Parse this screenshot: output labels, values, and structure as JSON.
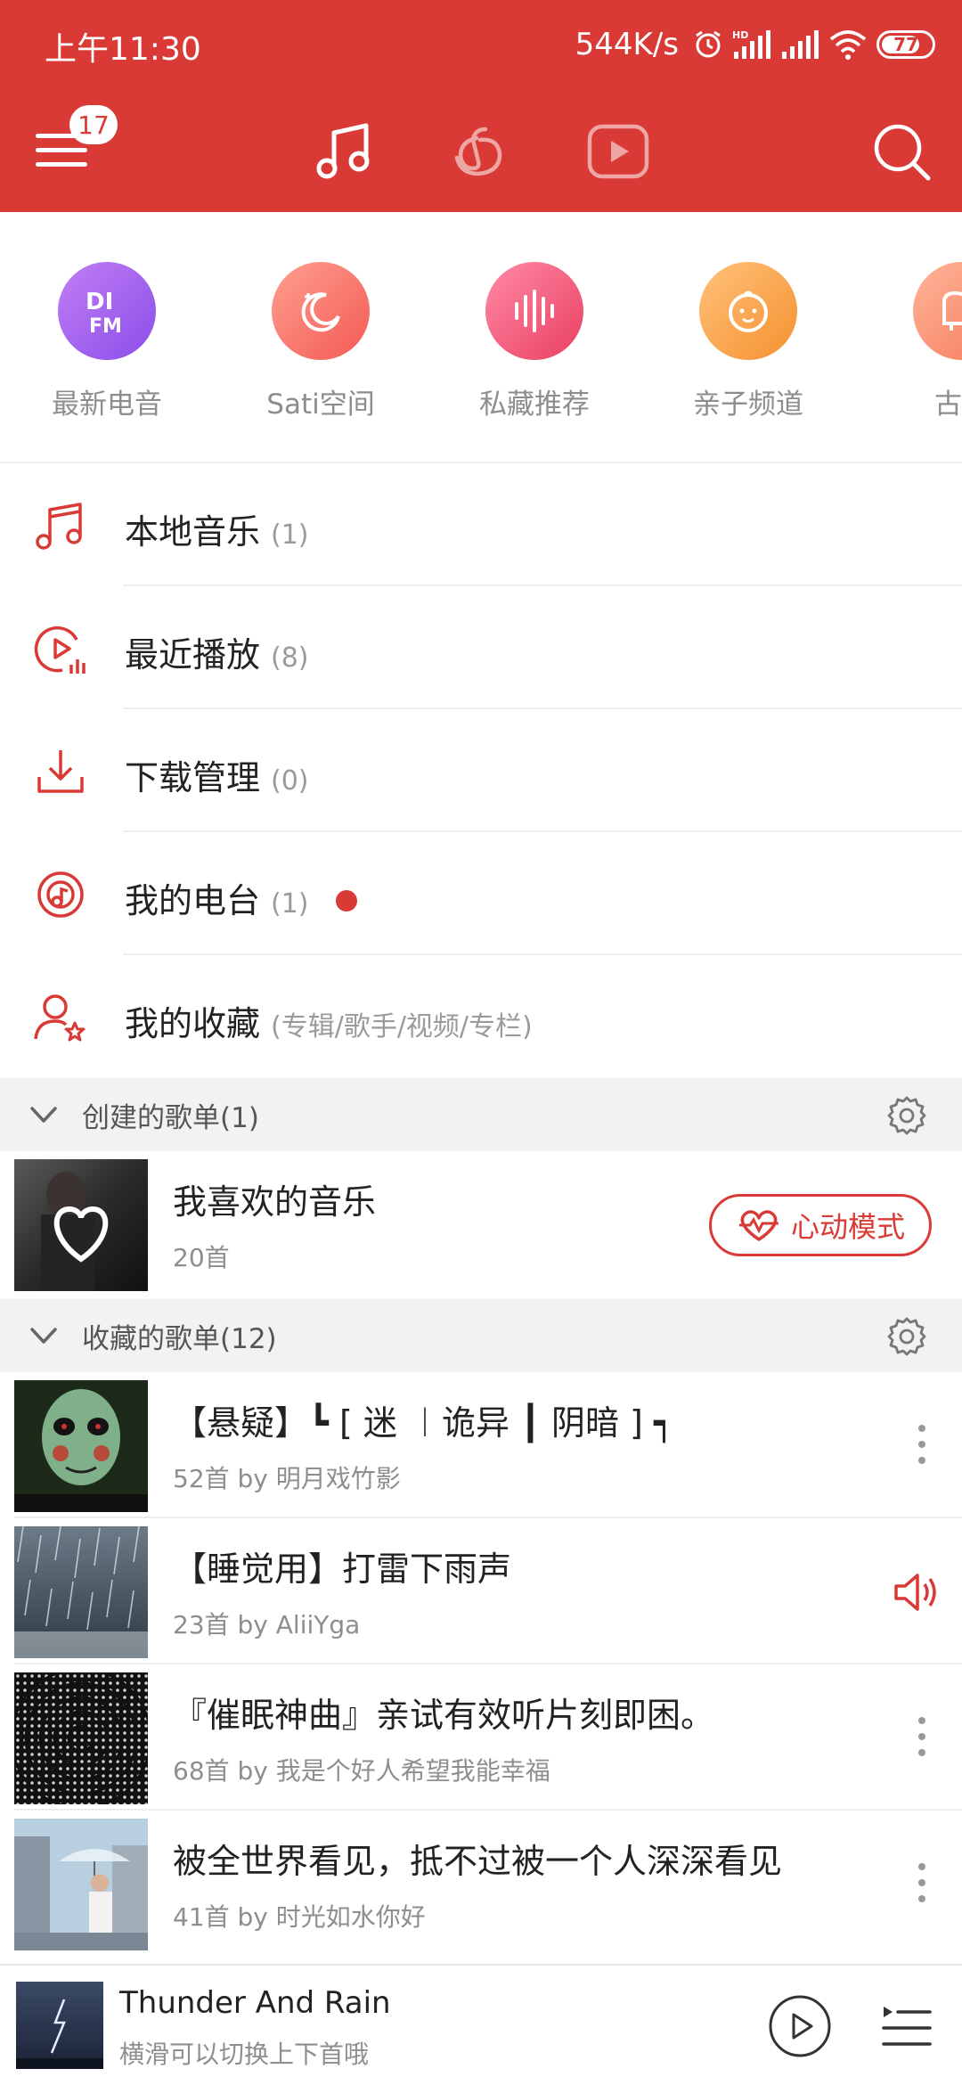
{
  "status_bar": {
    "time": "上午11:30",
    "speed": "544K/s",
    "battery": "77"
  },
  "nav": {
    "menu_badge": "17"
  },
  "channels": [
    {
      "label": "最新电音",
      "icon": "di-fm-icon"
    },
    {
      "label": "Sati空间",
      "icon": "moon-icon"
    },
    {
      "label": "私藏推荐",
      "icon": "sound-wave-icon"
    },
    {
      "label": "亲子频道",
      "icon": "baby-face-icon"
    },
    {
      "label": "古典",
      "icon": "piano-icon"
    }
  ],
  "my_items": [
    {
      "label": "本地音乐",
      "count": "(1)",
      "icon": "music-note-icon"
    },
    {
      "label": "最近播放",
      "count": "(8)",
      "icon": "recent-play-icon"
    },
    {
      "label": "下载管理",
      "count": "(0)",
      "icon": "download-icon"
    },
    {
      "label": "我的电台",
      "count": "(1)",
      "icon": "radio-icon"
    },
    {
      "label": "我的收藏",
      "count": "(专辑/歌手/视频/专栏)",
      "icon": "favorite-user-icon"
    }
  ],
  "created_section": {
    "title": "创建的歌单(1)"
  },
  "liked_playlist": {
    "name": "我喜欢的音乐",
    "meta": "20首",
    "heart_mode_label": "心动模式"
  },
  "collected_section": {
    "title": "收藏的歌单(12)"
  },
  "collected_playlists": [
    {
      "name": "【悬疑】┗ [ 迷 ︱诡异 ┃ 阴暗 ] ┑",
      "meta": "52首 by 明月戏竹影"
    },
    {
      "name": "【睡觉用】打雷下雨声",
      "meta": "23首 by AliiYga"
    },
    {
      "name": "『催眠神曲』亲试有效听片刻即困。",
      "meta": "68首 by 我是个好人希望我能幸福"
    },
    {
      "name": "被全世界看见，抵不过被一个人深深看见",
      "meta": "41首 by 时光如水你好"
    }
  ],
  "player": {
    "song": "Thunder And Rain",
    "hint": "横滑可以切换上下首哦"
  },
  "colors": {
    "brand_red": "#d93a36"
  }
}
